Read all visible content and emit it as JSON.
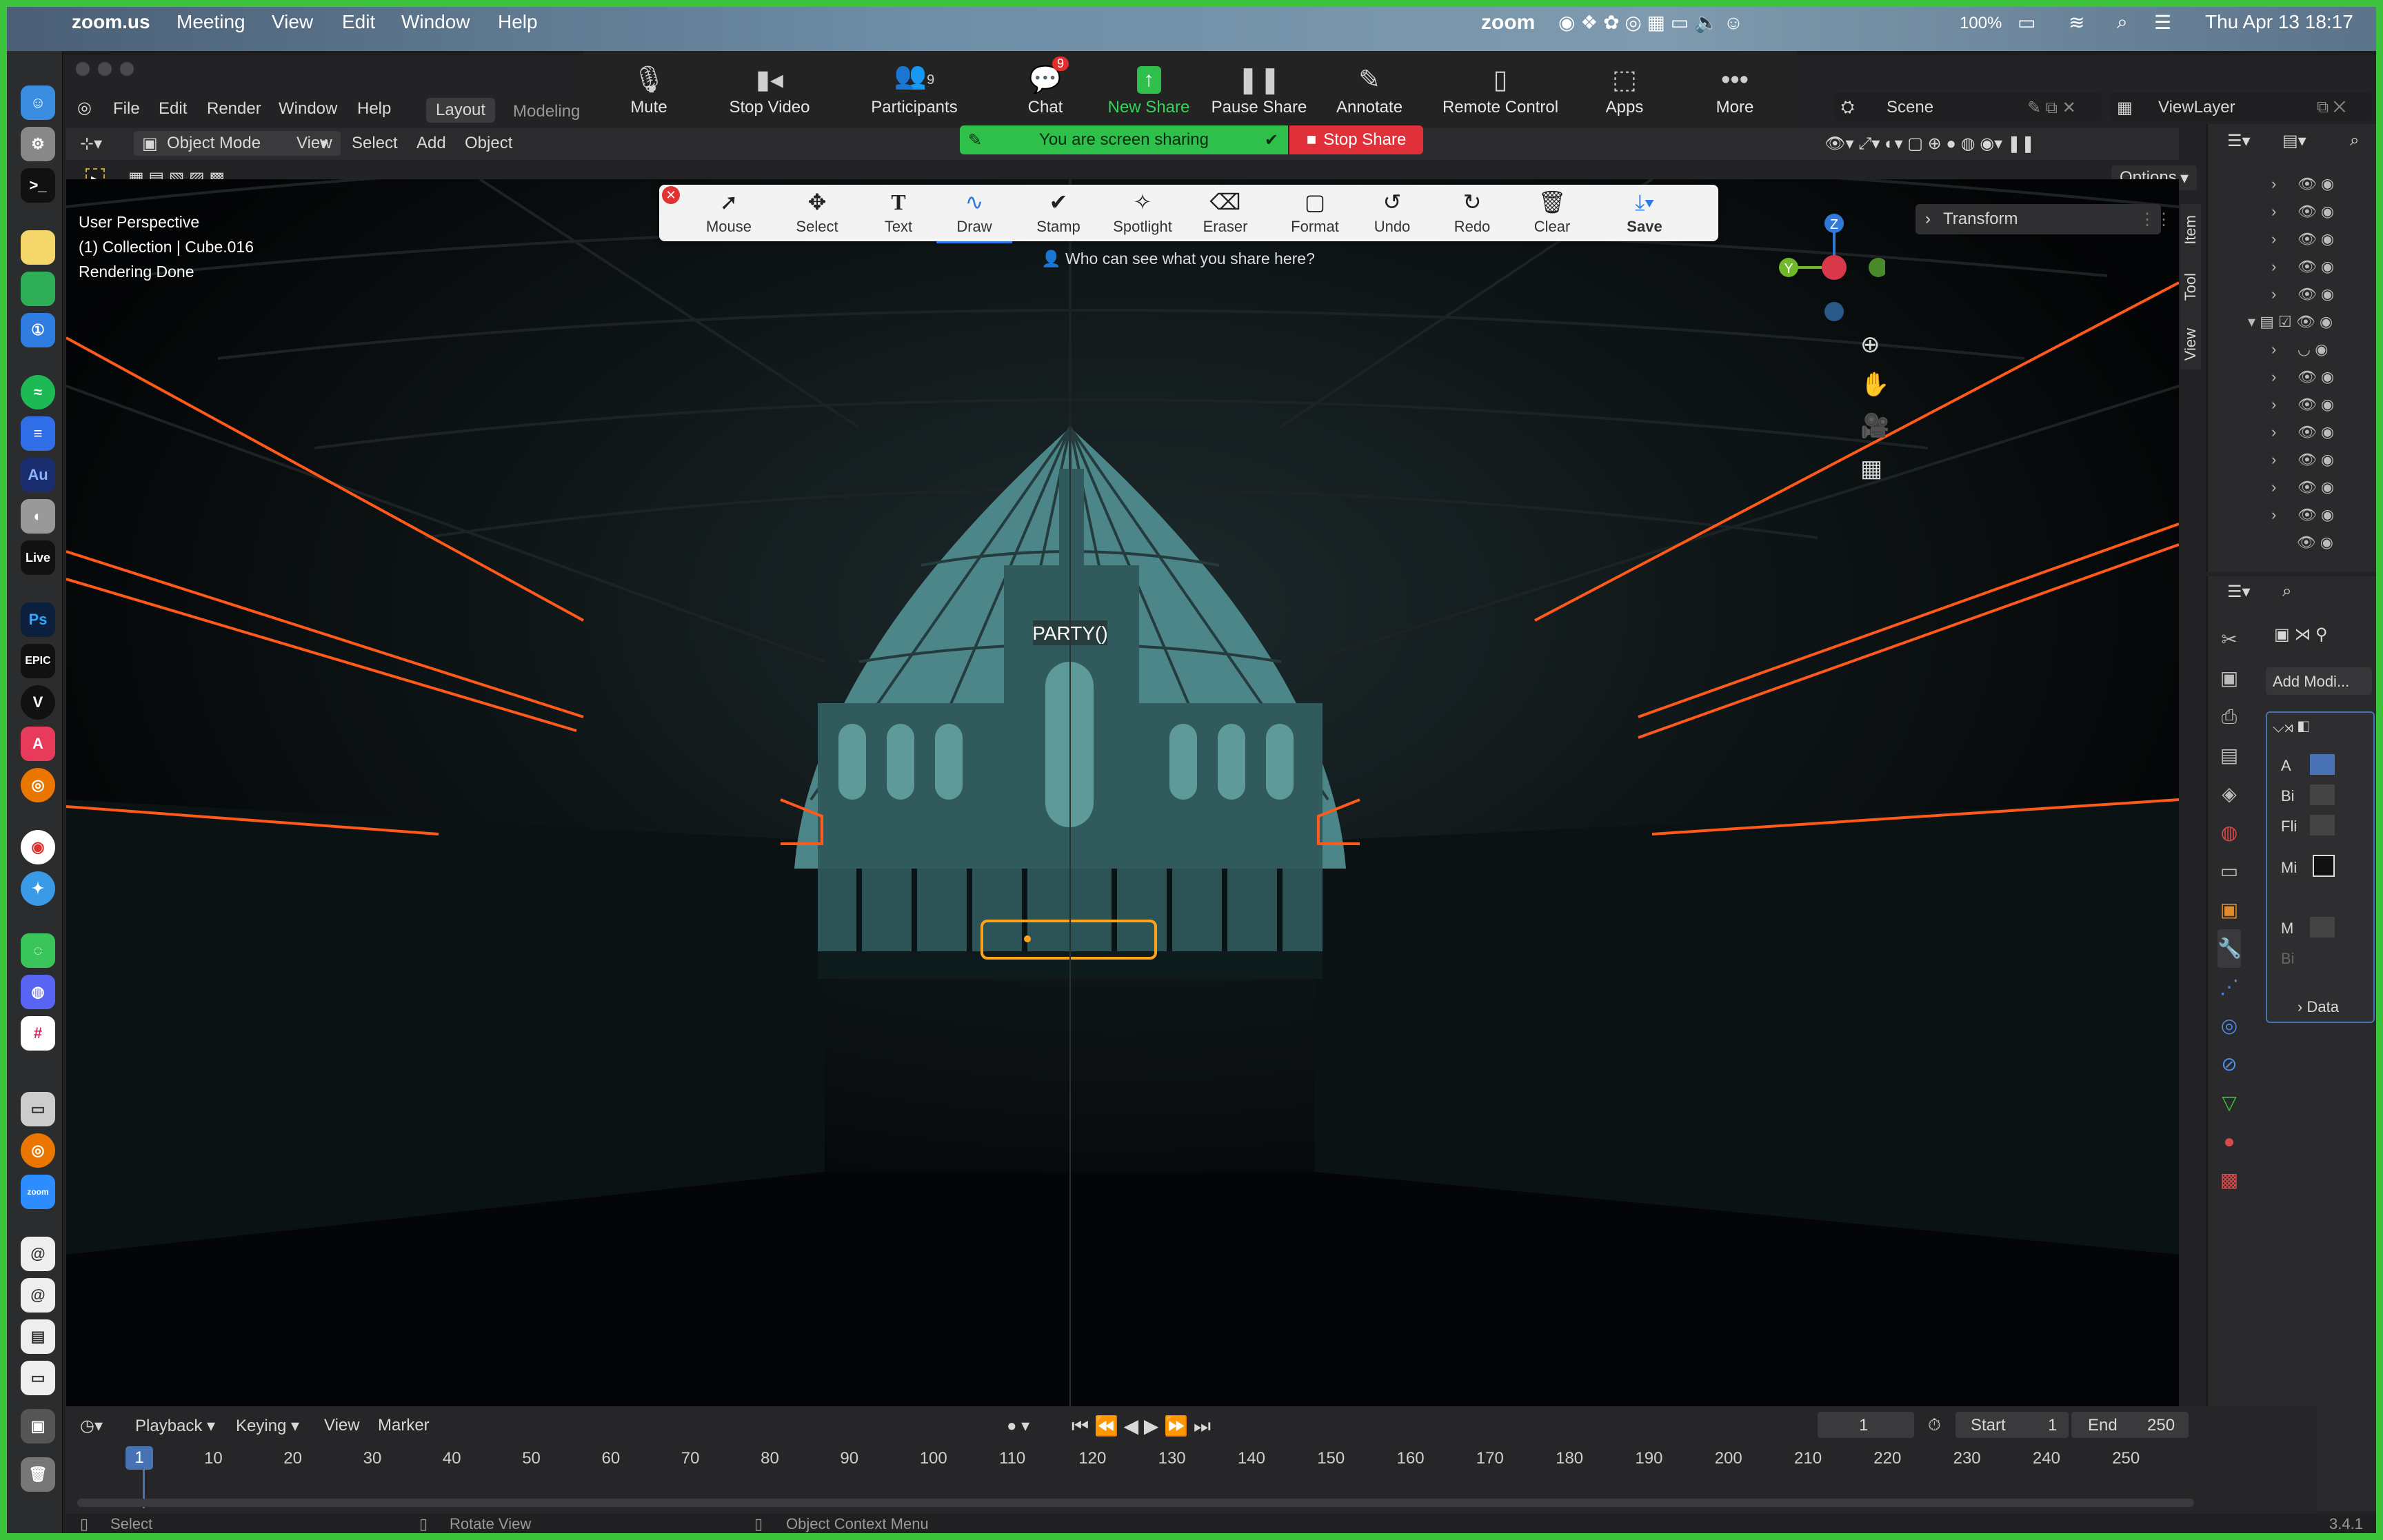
{
  "menubar": {
    "app_name": "zoom.us",
    "items": [
      "Meeting",
      "View",
      "Edit",
      "Window",
      "Help"
    ],
    "zoom_logo": "zoom",
    "battery": "100%",
    "datetime": "Thu Apr 13  18:17"
  },
  "zoom_controls": {
    "mute": "Mute",
    "stop_video": "Stop Video",
    "participants": "Participants",
    "participants_count": "9",
    "chat": "Chat",
    "chat_badge": "9",
    "new_share": "New Share",
    "pause_share": "Pause Share",
    "annotate": "Annotate",
    "remote_control": "Remote Control",
    "apps": "Apps",
    "more": "More"
  },
  "share_banner": {
    "status": "You are screen sharing",
    "stop": "Stop Share"
  },
  "annotate_toolbar": {
    "tools": [
      "Mouse",
      "Select",
      "Text",
      "Draw",
      "Stamp",
      "Spotlight",
      "Eraser",
      "Format",
      "Undo",
      "Redo",
      "Clear",
      "Save"
    ],
    "active": "Draw",
    "hint": "Who can see what you share here?"
  },
  "blender": {
    "menu": [
      "File",
      "Edit",
      "Render",
      "Window",
      "Help"
    ],
    "workspaces": [
      "Layout",
      "Modeling"
    ],
    "active_workspace": "Layout",
    "mode": "Object Mode",
    "header_menu": [
      "View",
      "Select",
      "Add",
      "Object"
    ],
    "scene": "Scene",
    "view_layer": "ViewLayer",
    "options": "Options",
    "overlay_text": [
      "User Perspective",
      "(1) Collection | Cube.016",
      "Rendering Done"
    ],
    "sign_text": "PARTY()",
    "n_panel_tabs": [
      "Item",
      "Tool",
      "View"
    ],
    "transform": "Transform",
    "gizmo": {
      "z": "Z",
      "y": "Y"
    },
    "properties": {
      "add_modifier": "Add Modi...",
      "rows": [
        "A",
        "Bi",
        "Fli",
        "Mi",
        "M",
        "Bi"
      ],
      "data": "Data"
    },
    "version": "3.4.1"
  },
  "timeline": {
    "menus": [
      "Playback",
      "Keying",
      "View",
      "Marker"
    ],
    "current_frame": "1",
    "start_label": "Start",
    "start": "1",
    "end_label": "End",
    "end": "250",
    "playhead": "1",
    "ticks": [
      "10",
      "20",
      "30",
      "40",
      "50",
      "60",
      "70",
      "80",
      "90",
      "100",
      "110",
      "120",
      "130",
      "140",
      "150",
      "160",
      "170",
      "180",
      "190",
      "200",
      "210",
      "220",
      "230",
      "240",
      "250"
    ]
  },
  "statusbar": {
    "select": "Select",
    "rotate": "Rotate View",
    "context": "Object Context Menu"
  },
  "colors": {
    "share_green": "#3cc43c",
    "orange_edge": "#ff5a1a",
    "dome_teal": "#5f9a9a",
    "blender_blue": "#4772b3"
  }
}
